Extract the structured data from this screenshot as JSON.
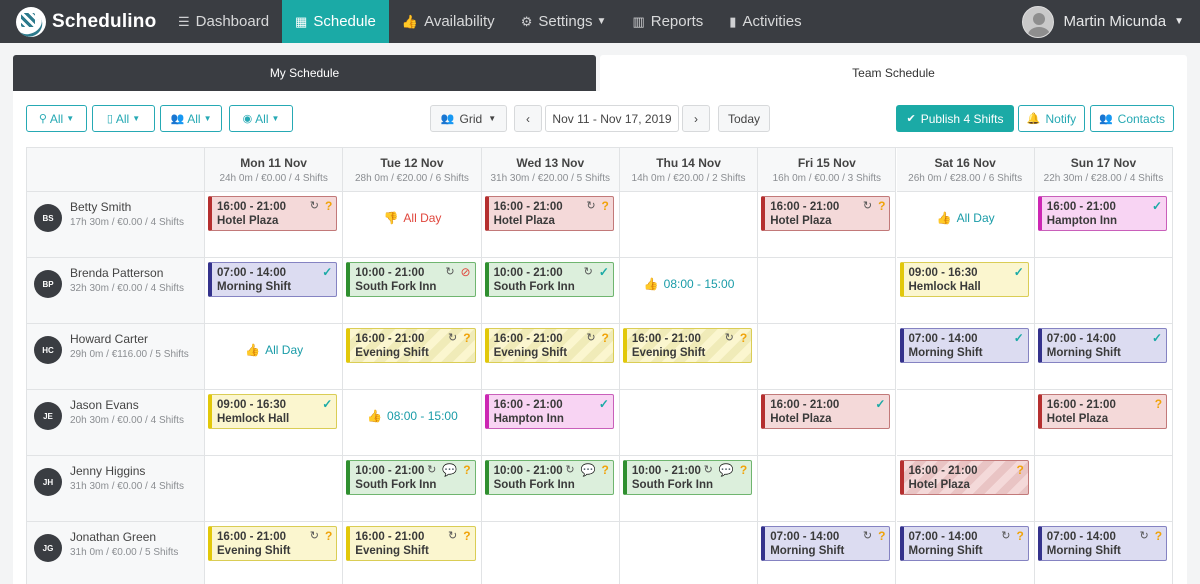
{
  "app": {
    "name": "Schedulino"
  },
  "nav": {
    "items": [
      {
        "label": "Dashboard",
        "icon": "list-icon"
      },
      {
        "label": "Schedule",
        "icon": "calendar-icon"
      },
      {
        "label": "Availability",
        "icon": "thumbs-up-icon"
      },
      {
        "label": "Settings",
        "icon": "gear-icon"
      },
      {
        "label": "Reports",
        "icon": "bar-chart-icon"
      },
      {
        "label": "Activities",
        "icon": "signal-icon"
      }
    ],
    "active": "Schedule",
    "user": "Martin Micunda"
  },
  "tabs": {
    "my": "My Schedule",
    "team": "Team Schedule"
  },
  "toolbar": {
    "filters": [
      "All",
      "All",
      "All",
      "All"
    ],
    "view": "Grid",
    "date_range": "Nov 11 - Nov 17, 2019",
    "today": "Today",
    "publish": "Publish 4 Shifts",
    "notify": "Notify",
    "contacts": "Contacts"
  },
  "days": [
    {
      "label": "Mon 11 Nov",
      "sub": "24h 0m / €0.00 / 4 Shifts"
    },
    {
      "label": "Tue 12 Nov",
      "sub": "28h 0m / €20.00 / 6 Shifts"
    },
    {
      "label": "Wed 13 Nov",
      "sub": "31h 30m / €20.00 / 5 Shifts"
    },
    {
      "label": "Thu 14 Nov",
      "sub": "14h 0m / €20.00 / 2 Shifts"
    },
    {
      "label": "Fri 15 Nov",
      "sub": "16h 0m / €0.00 / 3 Shifts"
    },
    {
      "label": "Sat 16 Nov",
      "sub": "26h 0m / €28.00 / 6 Shifts"
    },
    {
      "label": "Sun 17 Nov",
      "sub": "22h 30m / €28.00 / 4 Shifts"
    }
  ],
  "employees": [
    {
      "initials": "BS",
      "name": "Betty Smith",
      "sub": "17h 30m / €0.00 / 4 Shifts"
    },
    {
      "initials": "BP",
      "name": "Brenda Patterson",
      "sub": "32h 30m / €0.00 / 4 Shifts"
    },
    {
      "initials": "HC",
      "name": "Howard Carter",
      "sub": "29h 0m / €116.00 / 5 Shifts"
    },
    {
      "initials": "JE",
      "name": "Jason Evans",
      "sub": "20h 30m / €0.00 / 4 Shifts"
    },
    {
      "initials": "JH",
      "name": "Jenny Higgins",
      "sub": "31h 30m / €0.00 / 4 Shifts"
    },
    {
      "initials": "JG",
      "name": "Jonathan Green",
      "sub": "31h 0m / €0.00 / 5 Shifts"
    }
  ],
  "cells": [
    [
      {
        "type": "shift",
        "time": "16:00 - 21:00",
        "place": "Hotel Plaza",
        "color": "red",
        "repeat": true,
        "status": "pending"
      },
      {
        "type": "avail",
        "kind": "unavailable",
        "text": "All Day"
      },
      {
        "type": "shift",
        "time": "16:00 - 21:00",
        "place": "Hotel Plaza",
        "color": "red",
        "repeat": true,
        "status": "pending"
      },
      {
        "type": "empty"
      },
      {
        "type": "shift",
        "time": "16:00 - 21:00",
        "place": "Hotel Plaza",
        "color": "red",
        "repeat": true,
        "status": "pending"
      },
      {
        "type": "avail",
        "kind": "available",
        "text": "All Day"
      },
      {
        "type": "shift",
        "time": "16:00 - 21:00",
        "place": "Hampton Inn",
        "color": "pink",
        "repeat": false,
        "status": "confirmed"
      }
    ],
    [
      {
        "type": "shift",
        "time": "07:00 - 14:00",
        "place": "Morning Shift",
        "color": "blue",
        "repeat": false,
        "status": "confirmed"
      },
      {
        "type": "shift",
        "time": "10:00 - 21:00",
        "place": "South Fork Inn",
        "color": "green",
        "repeat": true,
        "status": "declined"
      },
      {
        "type": "shift",
        "time": "10:00 - 21:00",
        "place": "South Fork Inn",
        "color": "green",
        "repeat": true,
        "status": "confirmed"
      },
      {
        "type": "avail",
        "kind": "available",
        "text": "08:00 - 15:00"
      },
      {
        "type": "empty"
      },
      {
        "type": "shift",
        "time": "09:00 - 16:30",
        "place": "Hemlock Hall",
        "color": "yellow",
        "repeat": false,
        "status": "confirmed"
      },
      {
        "type": "empty"
      }
    ],
    [
      {
        "type": "avail",
        "kind": "available",
        "text": "All Day"
      },
      {
        "type": "shift",
        "time": "16:00 - 21:00",
        "place": "Evening Shift",
        "color": "ystripe",
        "repeat": true,
        "status": "pending"
      },
      {
        "type": "shift",
        "time": "16:00 - 21:00",
        "place": "Evening Shift",
        "color": "ystripe",
        "repeat": true,
        "status": "pending"
      },
      {
        "type": "shift",
        "time": "16:00 - 21:00",
        "place": "Evening Shift",
        "color": "ystripe",
        "repeat": true,
        "status": "pending"
      },
      {
        "type": "empty"
      },
      {
        "type": "shift",
        "time": "07:00 - 14:00",
        "place": "Morning Shift",
        "color": "blue",
        "repeat": false,
        "status": "confirmed"
      },
      {
        "type": "shift",
        "time": "07:00 - 14:00",
        "place": "Morning Shift",
        "color": "blue",
        "repeat": false,
        "status": "confirmed"
      }
    ],
    [
      {
        "type": "shift",
        "time": "09:00 - 16:30",
        "place": "Hemlock Hall",
        "color": "yellow",
        "repeat": false,
        "status": "confirmed"
      },
      {
        "type": "avail",
        "kind": "available",
        "text": "08:00 - 15:00"
      },
      {
        "type": "shift",
        "time": "16:00 - 21:00",
        "place": "Hampton Inn",
        "color": "pink",
        "repeat": false,
        "status": "confirmed"
      },
      {
        "type": "empty"
      },
      {
        "type": "shift",
        "time": "16:00 - 21:00",
        "place": "Hotel Plaza",
        "color": "red",
        "repeat": false,
        "status": "confirmed"
      },
      {
        "type": "empty"
      },
      {
        "type": "shift",
        "time": "16:00 - 21:00",
        "place": "Hotel Plaza",
        "color": "red",
        "repeat": false,
        "status": "pending"
      }
    ],
    [
      {
        "type": "empty"
      },
      {
        "type": "shift",
        "time": "10:00 - 21:00",
        "place": "South Fork Inn",
        "color": "green",
        "repeat": true,
        "comment": true,
        "status": "pending"
      },
      {
        "type": "shift",
        "time": "10:00 - 21:00",
        "place": "South Fork Inn",
        "color": "green",
        "repeat": true,
        "comment": true,
        "status": "pending"
      },
      {
        "type": "shift",
        "time": "10:00 - 21:00",
        "place": "South Fork Inn",
        "color": "green",
        "repeat": true,
        "comment": true,
        "status": "pending"
      },
      {
        "type": "empty"
      },
      {
        "type": "shift",
        "time": "16:00 - 21:00",
        "place": "Hotel Plaza",
        "color": "rstripe",
        "repeat": false,
        "status": "pending"
      },
      {
        "type": "empty"
      }
    ],
    [
      {
        "type": "shift",
        "time": "16:00 - 21:00",
        "place": "Evening Shift",
        "color": "yellow",
        "repeat": true,
        "status": "pending"
      },
      {
        "type": "shift",
        "time": "16:00 - 21:00",
        "place": "Evening Shift",
        "color": "yellow",
        "repeat": true,
        "status": "pending"
      },
      {
        "type": "empty"
      },
      {
        "type": "empty"
      },
      {
        "type": "shift",
        "time": "07:00 - 14:00",
        "place": "Morning Shift",
        "color": "blue",
        "repeat": true,
        "status": "pending"
      },
      {
        "type": "shift",
        "time": "07:00 - 14:00",
        "place": "Morning Shift",
        "color": "blue",
        "repeat": true,
        "status": "pending"
      },
      {
        "type": "shift",
        "time": "07:00 - 14:00",
        "place": "Morning Shift",
        "color": "blue",
        "repeat": true,
        "status": "pending"
      }
    ]
  ],
  "colors": {
    "accent": "#1baaa6",
    "navbar": "#3a3d42",
    "pending": "#f0a30a",
    "declined": "#e0473e"
  }
}
